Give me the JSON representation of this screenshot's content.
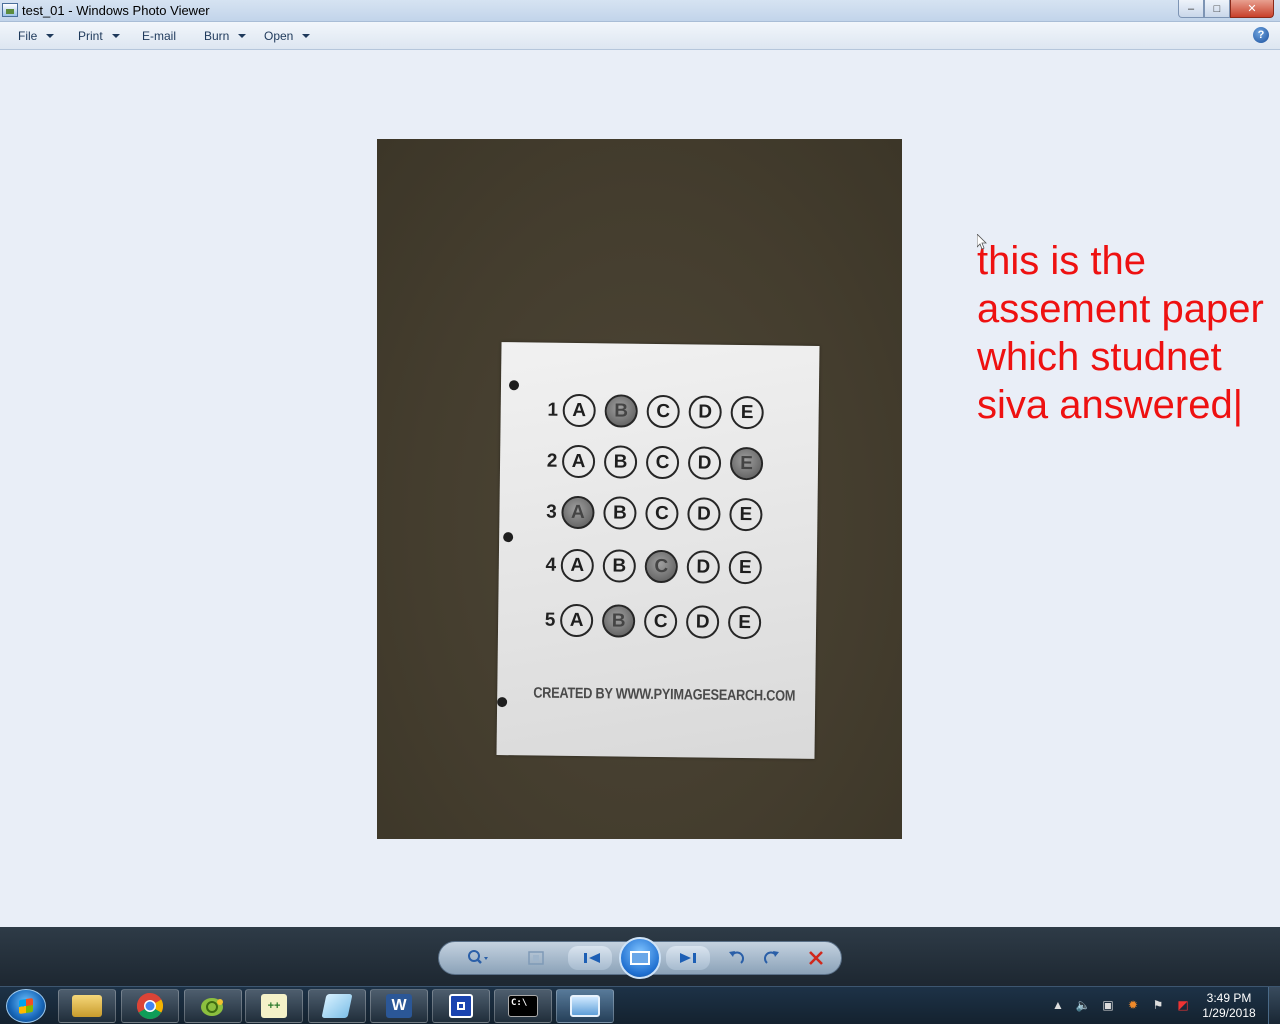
{
  "window": {
    "title": "test_01 - Windows Photo Viewer",
    "minimize": "–",
    "maximize": "□",
    "close": "✕"
  },
  "menu": {
    "items": [
      {
        "label": "File",
        "dropdown": true
      },
      {
        "label": "Print",
        "dropdown": true
      },
      {
        "label": "E-mail",
        "dropdown": false
      },
      {
        "label": "Burn",
        "dropdown": true
      },
      {
        "label": "Open",
        "dropdown": true
      }
    ],
    "help": "?"
  },
  "photo": {
    "questions": [
      {
        "number": "1",
        "options": [
          "A",
          "B",
          "C",
          "D",
          "E"
        ],
        "filled": "B"
      },
      {
        "number": "2",
        "options": [
          "A",
          "B",
          "C",
          "D",
          "E"
        ],
        "filled": "E"
      },
      {
        "number": "3",
        "options": [
          "A",
          "B",
          "C",
          "D",
          "E"
        ],
        "filled": "A"
      },
      {
        "number": "4",
        "options": [
          "A",
          "B",
          "C",
          "D",
          "E"
        ],
        "filled": "C"
      },
      {
        "number": "5",
        "options": [
          "A",
          "B",
          "C",
          "D",
          "E"
        ],
        "filled": "B"
      }
    ],
    "credit": "CREATED BY WWW.PYIMAGESEARCH.COM"
  },
  "annotation": {
    "lines": [
      "this is the",
      "assement paper",
      "which studnet",
      "siva answered|"
    ],
    "color": "#ee1111"
  },
  "viewer_toolbar": {
    "buttons": [
      "zoom-icon",
      "actual-size-icon",
      "previous-icon",
      "slideshow-icon",
      "next-icon",
      "rotate-left-icon",
      "rotate-right-icon",
      "delete-icon"
    ]
  },
  "taskbar": {
    "apps": [
      "windows-explorer-icon",
      "chrome-icon",
      "app-icon",
      "notepad-plus-icon",
      "notepad-icon",
      "word-icon",
      "app-icon",
      "cmd-icon",
      "photo-viewer-icon"
    ],
    "word_glyph": "W",
    "cmd_glyph": "C:\\",
    "time": "3:49 PM",
    "date": "1/29/2018"
  }
}
